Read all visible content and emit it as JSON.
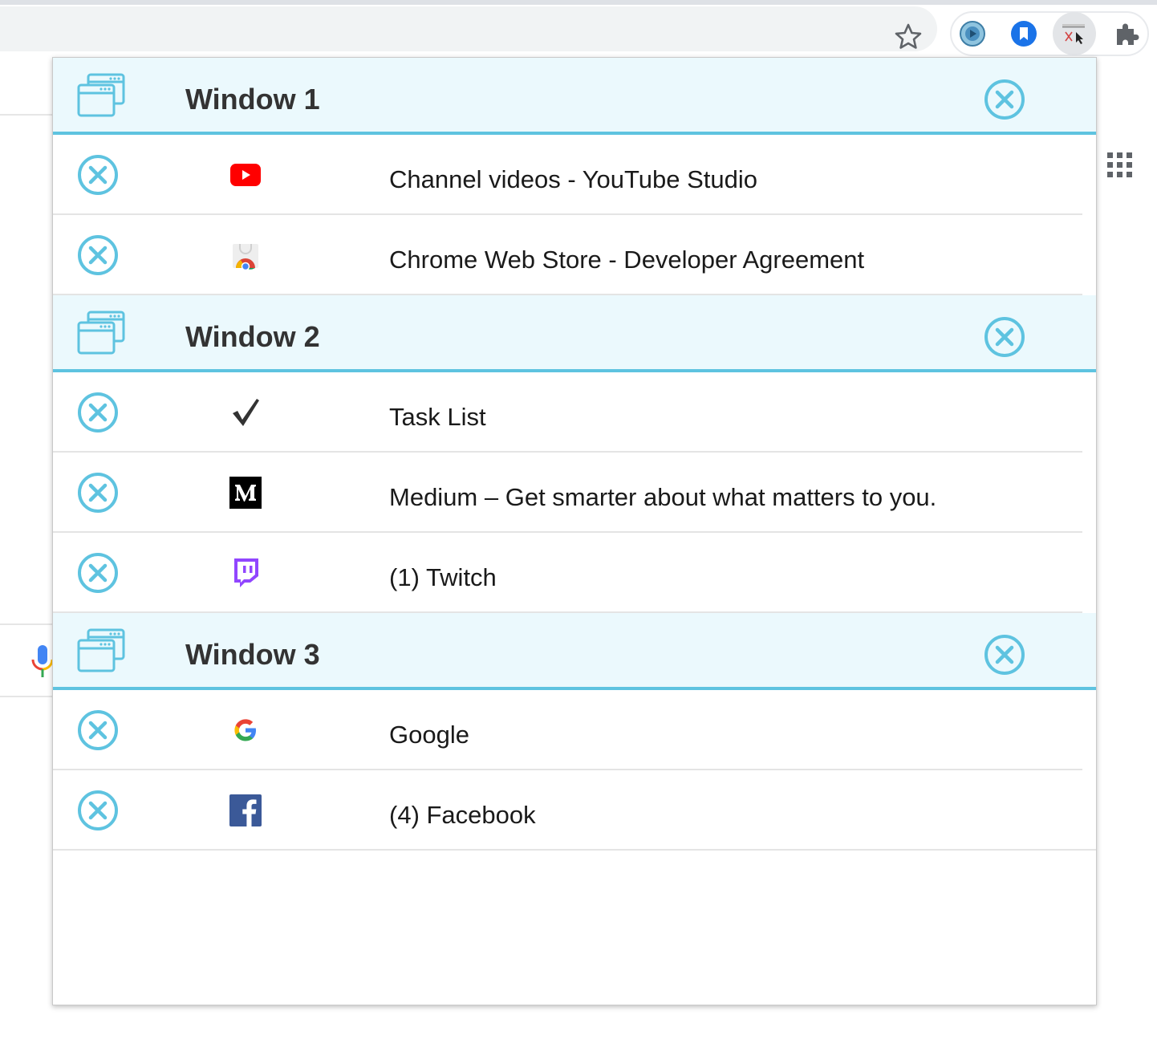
{
  "toolbar": {
    "icons": [
      "star-icon",
      "media-extension-icon",
      "bookmark-extension-icon",
      "tab-manager-extension-icon",
      "puzzle-icon"
    ]
  },
  "accent_color": "#5ec3e0",
  "windows": [
    {
      "title": "Window 1",
      "tabs": [
        {
          "title": "Channel videos - YouTube Studio",
          "icon": "youtube-icon"
        },
        {
          "title": "Chrome Web Store - Developer Agreement",
          "icon": "chrome-web-store-icon"
        }
      ]
    },
    {
      "title": "Window 2",
      "tabs": [
        {
          "title": "Task List",
          "icon": "checkmark-icon"
        },
        {
          "title": "Medium – Get smarter about what matters to you.",
          "icon": "medium-icon"
        },
        {
          "title": "(1) Twitch",
          "icon": "twitch-icon"
        }
      ]
    },
    {
      "title": "Window 3",
      "tabs": [
        {
          "title": "Google",
          "icon": "google-icon"
        },
        {
          "title": "(4) Facebook",
          "icon": "facebook-icon"
        }
      ]
    }
  ]
}
